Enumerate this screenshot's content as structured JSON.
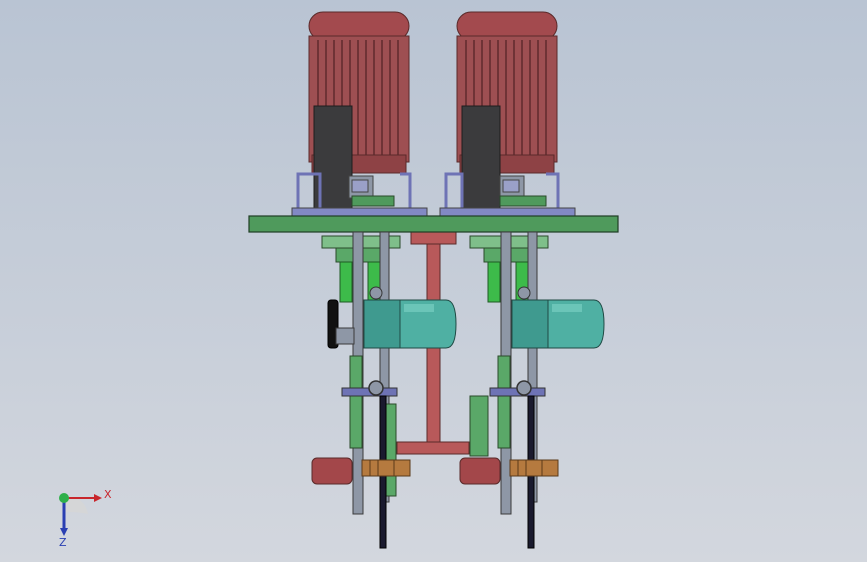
{
  "viewport": {
    "background_top": "#b9c4d3",
    "background_bottom": "#d3d7de"
  },
  "model": {
    "colors": {
      "motor": "#9e4f52",
      "motor_dark": "#6f3336",
      "motor_light": "#c0767a",
      "plate": "#4f9a5c",
      "frame_pink": "#b8595a",
      "gearbox": "#3f9a8f",
      "gearbox_light": "#6fc3b6",
      "steel": "#8e97a6",
      "dark_block": "#3b3b3d",
      "bracket_blue": "#6e73b5",
      "roller": "#a3474a",
      "brass": "#b57a3f",
      "green_part": "#3dbb4a"
    }
  },
  "triad": {
    "x_label": "X",
    "z_label": "Z",
    "x_color": "#c8262c",
    "z_color": "#2a3fb2",
    "y_color": "#2fb04a"
  }
}
